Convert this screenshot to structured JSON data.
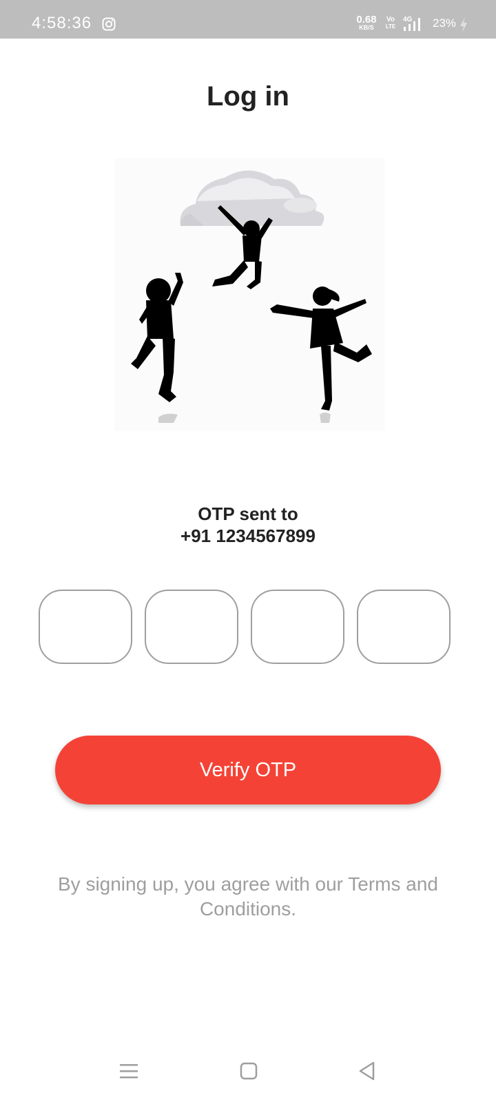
{
  "status_bar": {
    "time": "4:58:36",
    "net_speed_value": "0.68",
    "net_speed_unit": "KB/S",
    "volte_line1": "Vo",
    "volte_line2": "LTE",
    "network_type": "4G",
    "battery": "23%",
    "icons": [
      "instagram-icon",
      "signal-icon",
      "charging-icon"
    ]
  },
  "page": {
    "title": "Log in"
  },
  "otp": {
    "line1": "OTP sent to",
    "line2": "+91 1234567899",
    "boxes": [
      "",
      "",
      "",
      ""
    ]
  },
  "actions": {
    "verify_label": "Verify OTP"
  },
  "terms": {
    "text": "By signing up, you agree with our Terms and Conditions."
  },
  "nav": {
    "icons": [
      "menu-icon",
      "home-square-icon",
      "back-triangle-icon"
    ]
  },
  "colors": {
    "accent": "#f44336",
    "status_bar": "#bdbdbd",
    "title": "#222222",
    "muted": "#9e9e9e"
  }
}
